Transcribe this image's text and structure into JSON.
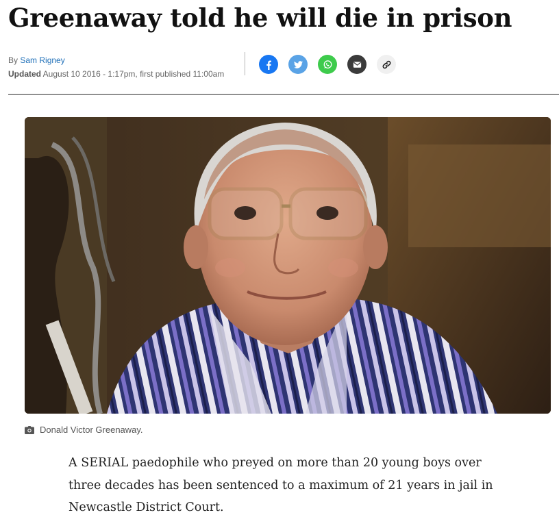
{
  "article": {
    "headline": "Greenaway told he will die in prison",
    "byline_prefix": "By",
    "author": "Sam Rigney",
    "updated_label": "Updated",
    "updated_text": "August 10 2016 - 1:17pm, first published 11:00am"
  },
  "share": {
    "buttons": [
      {
        "name": "facebook",
        "color": "#1877f2",
        "icon": "facebook-icon"
      },
      {
        "name": "twitter",
        "color": "#5aa3e6",
        "icon": "twitter-bird-icon"
      },
      {
        "name": "whatsapp",
        "color": "#3ecb4c",
        "icon": "whatsapp-icon"
      },
      {
        "name": "email",
        "color": "#3b3b3b",
        "icon": "envelope-icon"
      },
      {
        "name": "copy-link",
        "color": "#f0f0f0",
        "icon": "link-icon"
      }
    ]
  },
  "image": {
    "caption": "Donald Victor Greenaway.",
    "caption_icon": "camera-icon"
  },
  "body": {
    "paragraph_1": "A SERIAL paedophile who preyed on more than 20 young boys over three decades has been sentenced to a maximum of 21 years in jail in Newcastle District Court."
  }
}
